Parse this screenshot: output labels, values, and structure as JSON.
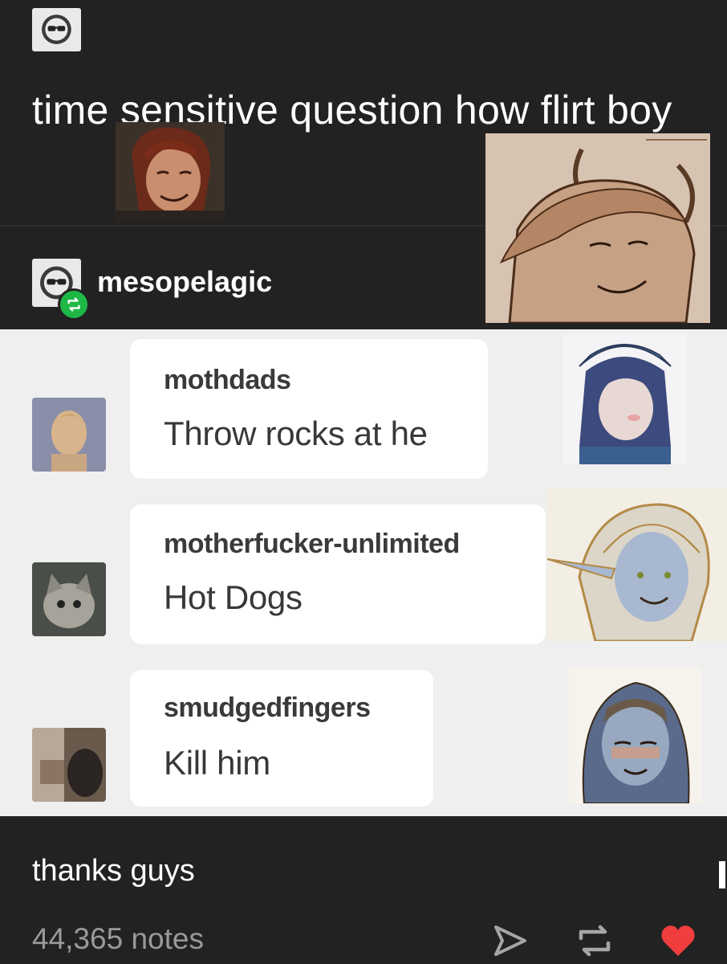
{
  "op_post": {
    "avatar_icon": "sunglasses-face-icon",
    "title": "time sensitive question how flirt boy"
  },
  "reblog": {
    "username": "mesopelagic",
    "avatar_icon": "sunglasses-face-icon",
    "badge_icon": "reblog-icon",
    "badge_color": "#1fb847"
  },
  "comments": [
    {
      "username": "mothdads",
      "message": "Throw rocks at he"
    },
    {
      "username": "motherfucker-unlimited",
      "message": "Hot Dogs"
    },
    {
      "username": "smudgedfingers",
      "message": "Kill him"
    }
  ],
  "footer": {
    "closing_text": "thanks guys",
    "notes": "44,365 notes",
    "share_icon": "send-icon",
    "reblog_icon": "reblog-icon",
    "like_icon": "heart-icon",
    "like_color": "#f03d3d"
  }
}
